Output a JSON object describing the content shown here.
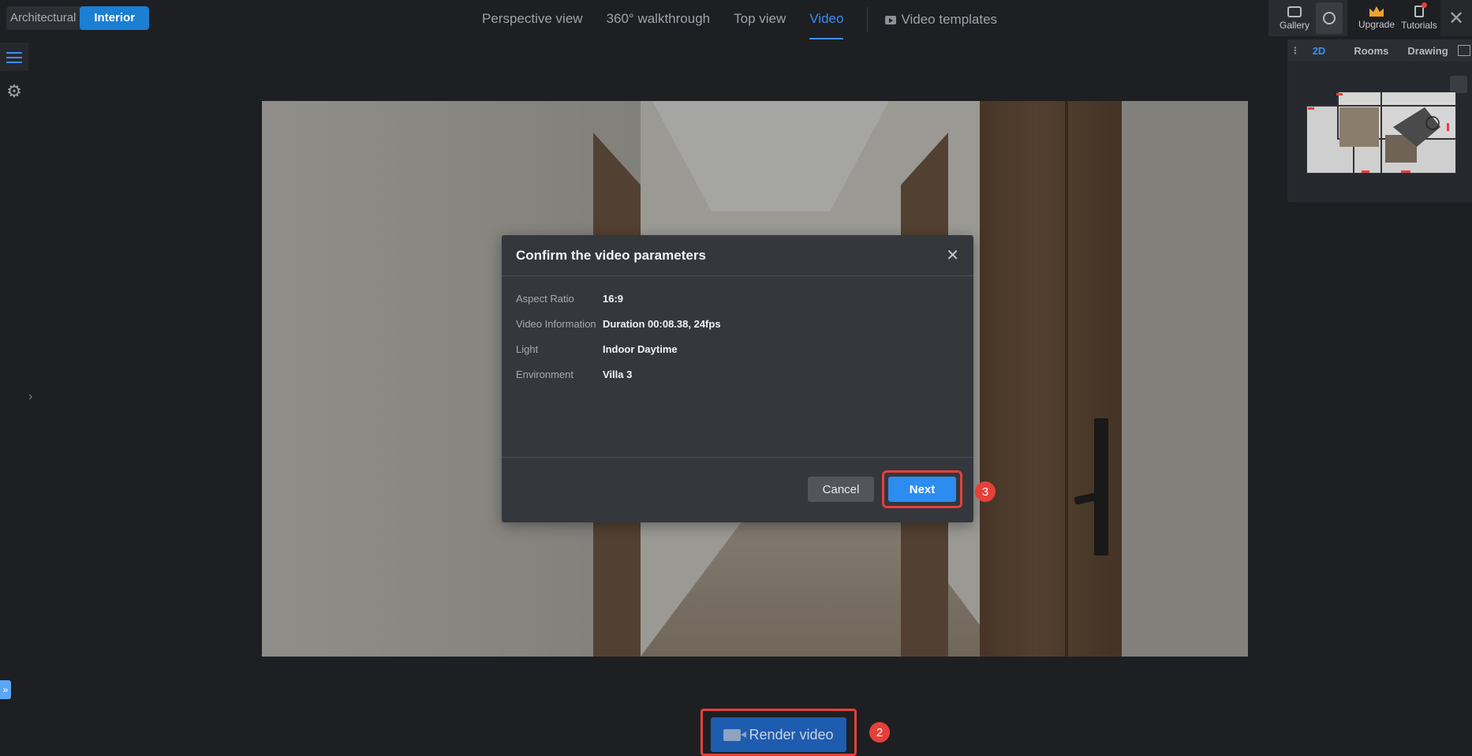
{
  "mode_toggle": {
    "architectural": "Architectural",
    "interior": "Interior"
  },
  "view_tabs": [
    {
      "label": "Perspective view"
    },
    {
      "label": "360° walkthrough"
    },
    {
      "label": "Top view"
    },
    {
      "label": "Video",
      "active": true
    }
  ],
  "video_templates": "Video templates",
  "top_right": {
    "gallery": "Gallery",
    "upgrade": "Upgrade",
    "tutorials": "Tutorials"
  },
  "minimap": {
    "tabs": [
      "2D",
      "Rooms",
      "Drawing"
    ]
  },
  "dialog": {
    "title": "Confirm the video parameters",
    "rows": [
      {
        "label": "Aspect Ratio",
        "value": "16:9"
      },
      {
        "label": "Video Information",
        "value": "Duration 00:08.38, 24fps"
      },
      {
        "label": "Light",
        "value": "Indoor Daytime"
      },
      {
        "label": "Environment",
        "value": "Villa 3"
      }
    ],
    "cancel": "Cancel",
    "next": "Next"
  },
  "render_button": "Render video",
  "step_badges": {
    "render": "2",
    "next": "3"
  },
  "colors": {
    "accent": "#3d8ef2",
    "highlight": "#e5403a",
    "primary_button": "#2d8cf0"
  }
}
